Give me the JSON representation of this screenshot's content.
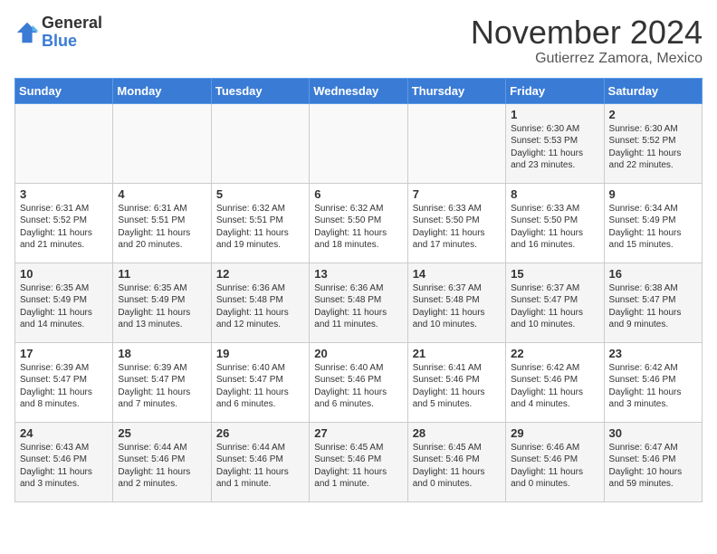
{
  "logo": {
    "general": "General",
    "blue": "Blue"
  },
  "title": {
    "month_year": "November 2024",
    "location": "Gutierrez Zamora, Mexico"
  },
  "headers": [
    "Sunday",
    "Monday",
    "Tuesday",
    "Wednesday",
    "Thursday",
    "Friday",
    "Saturday"
  ],
  "weeks": [
    [
      {
        "day": "",
        "info": ""
      },
      {
        "day": "",
        "info": ""
      },
      {
        "day": "",
        "info": ""
      },
      {
        "day": "",
        "info": ""
      },
      {
        "day": "",
        "info": ""
      },
      {
        "day": "1",
        "info": "Sunrise: 6:30 AM\nSunset: 5:53 PM\nDaylight: 11 hours\nand 23 minutes."
      },
      {
        "day": "2",
        "info": "Sunrise: 6:30 AM\nSunset: 5:52 PM\nDaylight: 11 hours\nand 22 minutes."
      }
    ],
    [
      {
        "day": "3",
        "info": "Sunrise: 6:31 AM\nSunset: 5:52 PM\nDaylight: 11 hours\nand 21 minutes."
      },
      {
        "day": "4",
        "info": "Sunrise: 6:31 AM\nSunset: 5:51 PM\nDaylight: 11 hours\nand 20 minutes."
      },
      {
        "day": "5",
        "info": "Sunrise: 6:32 AM\nSunset: 5:51 PM\nDaylight: 11 hours\nand 19 minutes."
      },
      {
        "day": "6",
        "info": "Sunrise: 6:32 AM\nSunset: 5:50 PM\nDaylight: 11 hours\nand 18 minutes."
      },
      {
        "day": "7",
        "info": "Sunrise: 6:33 AM\nSunset: 5:50 PM\nDaylight: 11 hours\nand 17 minutes."
      },
      {
        "day": "8",
        "info": "Sunrise: 6:33 AM\nSunset: 5:50 PM\nDaylight: 11 hours\nand 16 minutes."
      },
      {
        "day": "9",
        "info": "Sunrise: 6:34 AM\nSunset: 5:49 PM\nDaylight: 11 hours\nand 15 minutes."
      }
    ],
    [
      {
        "day": "10",
        "info": "Sunrise: 6:35 AM\nSunset: 5:49 PM\nDaylight: 11 hours\nand 14 minutes."
      },
      {
        "day": "11",
        "info": "Sunrise: 6:35 AM\nSunset: 5:49 PM\nDaylight: 11 hours\nand 13 minutes."
      },
      {
        "day": "12",
        "info": "Sunrise: 6:36 AM\nSunset: 5:48 PM\nDaylight: 11 hours\nand 12 minutes."
      },
      {
        "day": "13",
        "info": "Sunrise: 6:36 AM\nSunset: 5:48 PM\nDaylight: 11 hours\nand 11 minutes."
      },
      {
        "day": "14",
        "info": "Sunrise: 6:37 AM\nSunset: 5:48 PM\nDaylight: 11 hours\nand 10 minutes."
      },
      {
        "day": "15",
        "info": "Sunrise: 6:37 AM\nSunset: 5:47 PM\nDaylight: 11 hours\nand 10 minutes."
      },
      {
        "day": "16",
        "info": "Sunrise: 6:38 AM\nSunset: 5:47 PM\nDaylight: 11 hours\nand 9 minutes."
      }
    ],
    [
      {
        "day": "17",
        "info": "Sunrise: 6:39 AM\nSunset: 5:47 PM\nDaylight: 11 hours\nand 8 minutes."
      },
      {
        "day": "18",
        "info": "Sunrise: 6:39 AM\nSunset: 5:47 PM\nDaylight: 11 hours\nand 7 minutes."
      },
      {
        "day": "19",
        "info": "Sunrise: 6:40 AM\nSunset: 5:47 PM\nDaylight: 11 hours\nand 6 minutes."
      },
      {
        "day": "20",
        "info": "Sunrise: 6:40 AM\nSunset: 5:46 PM\nDaylight: 11 hours\nand 6 minutes."
      },
      {
        "day": "21",
        "info": "Sunrise: 6:41 AM\nSunset: 5:46 PM\nDaylight: 11 hours\nand 5 minutes."
      },
      {
        "day": "22",
        "info": "Sunrise: 6:42 AM\nSunset: 5:46 PM\nDaylight: 11 hours\nand 4 minutes."
      },
      {
        "day": "23",
        "info": "Sunrise: 6:42 AM\nSunset: 5:46 PM\nDaylight: 11 hours\nand 3 minutes."
      }
    ],
    [
      {
        "day": "24",
        "info": "Sunrise: 6:43 AM\nSunset: 5:46 PM\nDaylight: 11 hours\nand 3 minutes."
      },
      {
        "day": "25",
        "info": "Sunrise: 6:44 AM\nSunset: 5:46 PM\nDaylight: 11 hours\nand 2 minutes."
      },
      {
        "day": "26",
        "info": "Sunrise: 6:44 AM\nSunset: 5:46 PM\nDaylight: 11 hours\nand 1 minute."
      },
      {
        "day": "27",
        "info": "Sunrise: 6:45 AM\nSunset: 5:46 PM\nDaylight: 11 hours\nand 1 minute."
      },
      {
        "day": "28",
        "info": "Sunrise: 6:45 AM\nSunset: 5:46 PM\nDaylight: 11 hours\nand 0 minutes."
      },
      {
        "day": "29",
        "info": "Sunrise: 6:46 AM\nSunset: 5:46 PM\nDaylight: 11 hours\nand 0 minutes."
      },
      {
        "day": "30",
        "info": "Sunrise: 6:47 AM\nSunset: 5:46 PM\nDaylight: 10 hours\nand 59 minutes."
      }
    ]
  ]
}
